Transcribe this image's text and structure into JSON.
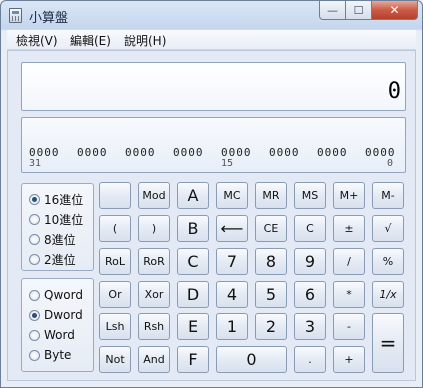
{
  "window": {
    "title": "小算盤"
  },
  "caption": {
    "minimize": "—",
    "maximize": "☐",
    "close": "✕"
  },
  "menu": [
    "檢視(V)",
    "編輯(E)",
    "說明(H)"
  ],
  "display": {
    "value": "0"
  },
  "bits": {
    "groups": [
      "0000",
      "0000",
      "0000",
      "0000",
      "0000",
      "0000",
      "0000",
      "0000"
    ],
    "labels": [
      "31",
      "15",
      "0"
    ]
  },
  "base_radios": [
    {
      "label": "16進位",
      "selected": true
    },
    {
      "label": "10進位",
      "selected": false
    },
    {
      "label": "8進位",
      "selected": false
    },
    {
      "label": "2進位",
      "selected": false
    }
  ],
  "word_radios": [
    {
      "label": "Qword",
      "selected": false
    },
    {
      "label": "Dword",
      "selected": true
    },
    {
      "label": "Word",
      "selected": false
    },
    {
      "label": "Byte",
      "selected": false
    }
  ],
  "keys": {
    "blank": "",
    "mod": "Mod",
    "a": "A",
    "mc": "MC",
    "mr": "MR",
    "ms": "MS",
    "mplus": "M+",
    "mminus": "M-",
    "lparen": "(",
    "rparen": ")",
    "b": "B",
    "backspace": "⟵",
    "ce": "CE",
    "c": "C",
    "plusminus": "±",
    "sqrt": "√",
    "rol": "RoL",
    "ror": "RoR",
    "hex_c": "C",
    "seven": "7",
    "eight": "8",
    "nine": "9",
    "divide": "/",
    "percent": "%",
    "or": "Or",
    "xor": "Xor",
    "d": "D",
    "four": "4",
    "five": "5",
    "six": "6",
    "multiply": "*",
    "reciprocal": "1/x",
    "lsh": "Lsh",
    "rsh": "Rsh",
    "e": "E",
    "one": "1",
    "two": "2",
    "three": "3",
    "minus": "-",
    "equals": "=",
    "not": "Not",
    "and": "And",
    "f": "F",
    "zero": "0",
    "decimal": ".",
    "plus": "+"
  }
}
